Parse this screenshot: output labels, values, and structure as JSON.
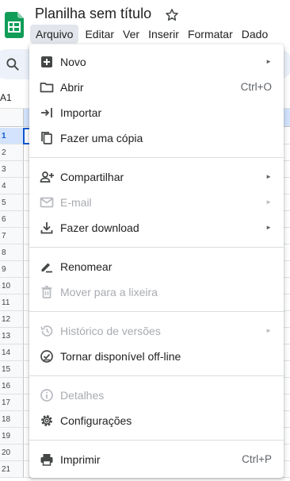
{
  "document": {
    "title": "Planilha sem título"
  },
  "menubar": {
    "items": [
      {
        "label": "Arquivo",
        "active": true
      },
      {
        "label": "Editar"
      },
      {
        "label": "Ver"
      },
      {
        "label": "Inserir"
      },
      {
        "label": "Formatar"
      },
      {
        "label": "Dado"
      }
    ]
  },
  "name_box": {
    "value": "A1"
  },
  "rows": [
    "1",
    "2",
    "3",
    "4",
    "5",
    "6",
    "7",
    "8",
    "9",
    "10",
    "11",
    "12",
    "13",
    "14",
    "15",
    "16",
    "17",
    "18",
    "19",
    "20",
    "21"
  ],
  "file_menu": {
    "items": [
      {
        "label": "Novo",
        "icon": "add-box-icon",
        "submenu": true,
        "disabled": false
      },
      {
        "label": "Abrir",
        "icon": "folder-icon",
        "shortcut": "Ctrl+O",
        "disabled": false
      },
      {
        "label": "Importar",
        "icon": "import-icon",
        "disabled": false
      },
      {
        "label": "Fazer uma cópia",
        "icon": "copy-icon",
        "disabled": false
      },
      {
        "label": "Compartilhar",
        "icon": "person-add-icon",
        "submenu": true,
        "disabled": false
      },
      {
        "label": "E-mail",
        "icon": "mail-icon",
        "submenu": true,
        "disabled": true
      },
      {
        "label": "Fazer download",
        "icon": "download-icon",
        "submenu": true,
        "disabled": false
      },
      {
        "label": "Renomear",
        "icon": "rename-icon",
        "disabled": false
      },
      {
        "label": "Mover para a lixeira",
        "icon": "trash-icon",
        "disabled": true
      },
      {
        "label": "Histórico de versões",
        "icon": "history-icon",
        "submenu": true,
        "disabled": true
      },
      {
        "label": "Tornar disponível off-line",
        "icon": "offline-icon",
        "disabled": false
      },
      {
        "label": "Detalhes",
        "icon": "info-icon",
        "disabled": true
      },
      {
        "label": "Configurações",
        "icon": "settings-icon",
        "disabled": false
      },
      {
        "label": "Imprimir",
        "icon": "print-icon",
        "shortcut": "Ctrl+P",
        "disabled": false
      }
    ],
    "submenu_arrow": "►"
  },
  "colors": {
    "brand_green": "#0f9d58",
    "accent_blue": "#0b57d0",
    "selection_blue": "#d3e3fd",
    "disabled_text": "#a8abb0"
  }
}
